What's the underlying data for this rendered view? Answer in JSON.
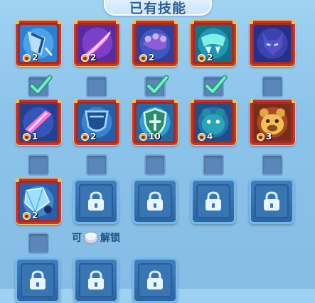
{
  "panel": {
    "title": "已有技能",
    "unlock_hint": {
      "prefix": "可",
      "suffix": "解锁",
      "coin_icon": "silver-coin-icon"
    }
  },
  "skills": [
    {
      "name": "claw-skill-icon",
      "level": "2",
      "checked": true,
      "color": "#2f7fd0"
    },
    {
      "name": "pink-slash-skill-icon",
      "level": "2",
      "checked": false,
      "color": "#7b2fb8"
    },
    {
      "name": "purple-claw-skill-icon",
      "level": "2",
      "checked": true,
      "color": "#3a4fb0"
    },
    {
      "name": "teal-fang-skill-icon",
      "level": "2",
      "checked": true,
      "color": "#1d8fa7"
    },
    {
      "name": "wolf-head-skill-icon",
      "level": "",
      "checked": false,
      "color": "#3a3fa8"
    },
    {
      "name": "crystal-slash-skill-icon",
      "level": "1",
      "checked": false,
      "color": "#2a4fa8"
    },
    {
      "name": "armor-skill-icon",
      "level": "2",
      "checked": false,
      "color": "#2d6fc0"
    },
    {
      "name": "shield-skill-icon",
      "level": "10",
      "checked": false,
      "color": "#2f8bc0"
    },
    {
      "name": "blue-bear-skill-icon",
      "level": "4",
      "checked": false,
      "color": "#2a5f9e"
    },
    {
      "name": "golden-bear-skill-icon",
      "level": "3",
      "checked": false,
      "color": "#7a3a22"
    },
    {
      "name": "crystal-spider-skill-icon",
      "level": "2",
      "checked": false,
      "color": "#2f6fb8"
    }
  ],
  "locked_slot_count": 7
}
